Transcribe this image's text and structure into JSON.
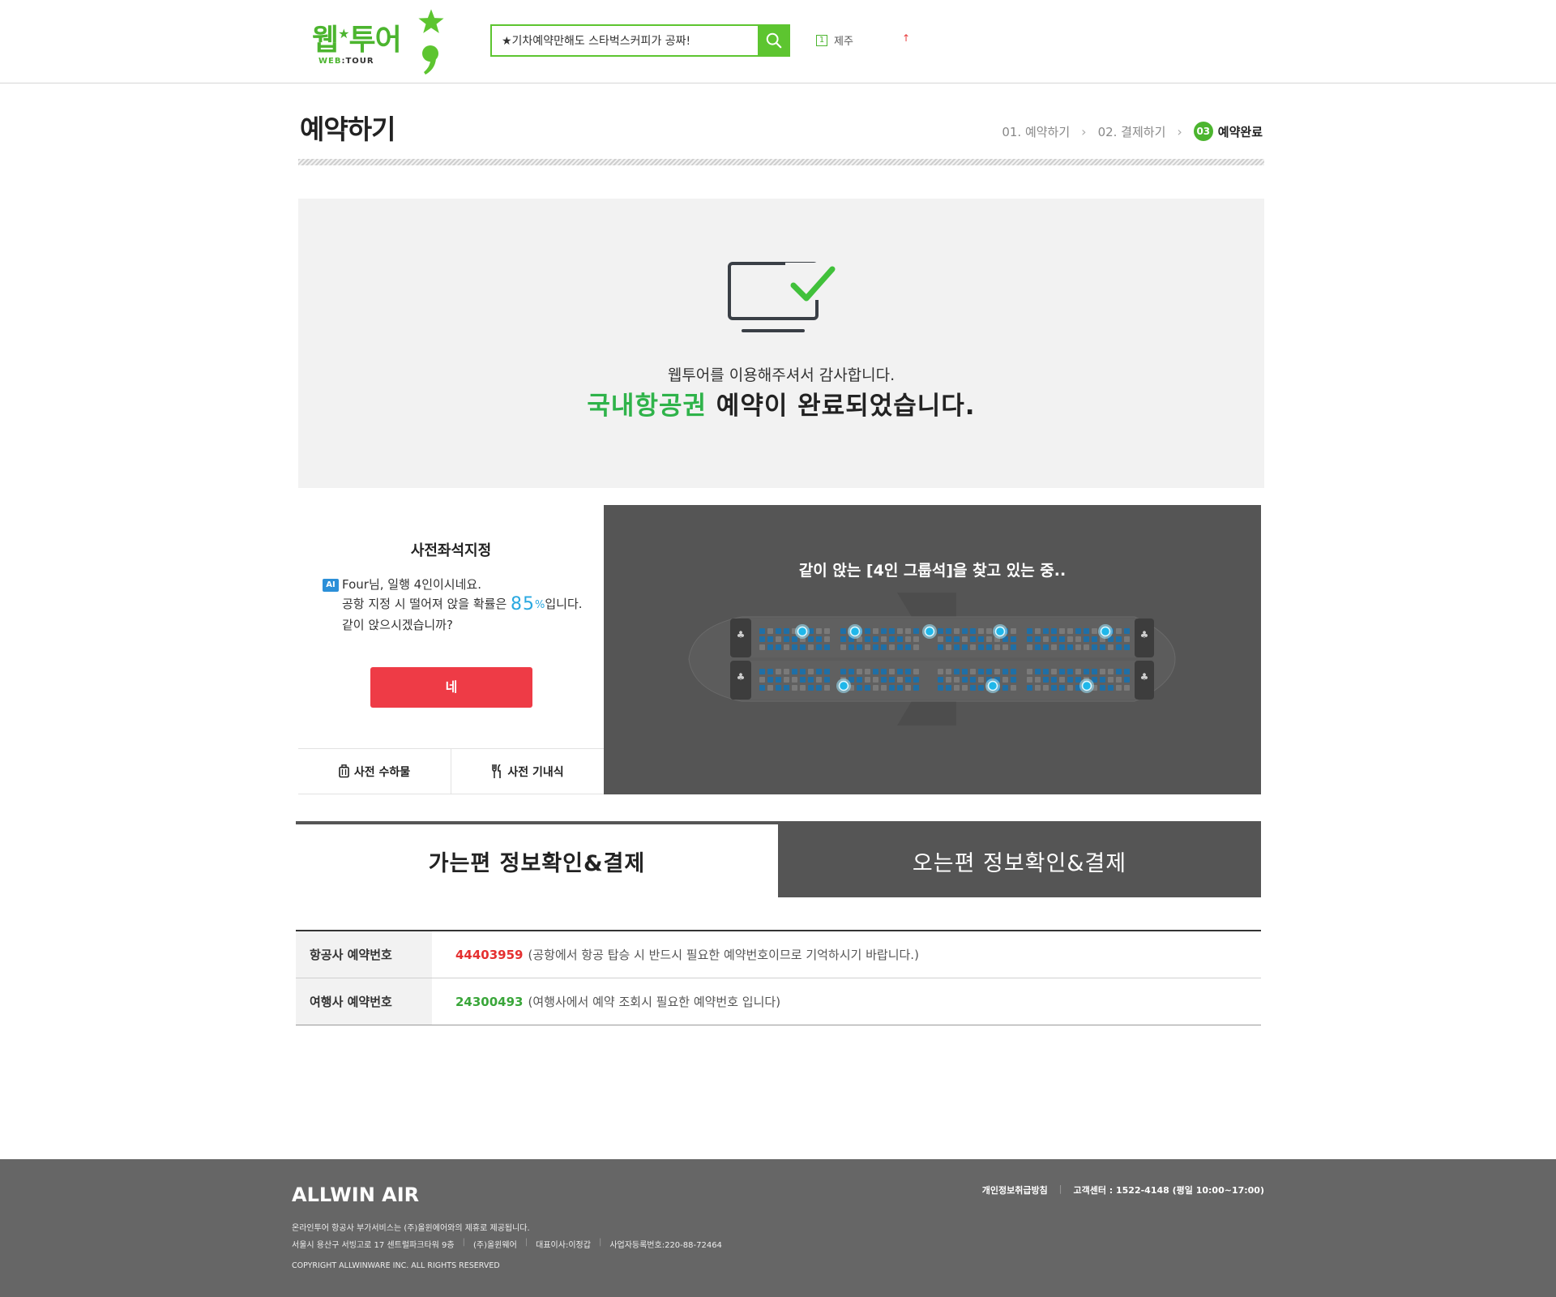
{
  "header": {
    "logo_main": "웹",
    "logo_semicolon": "★",
    "logo_tail": "투어",
    "logo_sub_a": "WEB",
    "logo_sub_b": "TOUR",
    "search_value": "★기차예약만해도 스타벅스커피가 공짜!",
    "rank_number": "1",
    "rank_keyword": "제주",
    "rank_trend": "↑"
  },
  "page": {
    "title": "예약하기",
    "steps": [
      {
        "label": "01. 예약하기"
      },
      {
        "label": "02. 결제하기"
      },
      {
        "number": "03",
        "label": "예약완료"
      }
    ]
  },
  "completion": {
    "thanks": "웹투어를 이용해주셔서 감사합니다.",
    "highlight": "국내항공권",
    "message": " 예약이 완료되었습니다."
  },
  "seat_promo": {
    "title": "사전좌석지정",
    "ai_badge": "AI",
    "line1": "Four님, 일행 4인이시네요.",
    "line2_pre": "공항 지정 시 떨어져 앉을 확률은 ",
    "percent": "85",
    "percent_sign": "%",
    "line2_post": "입니다.",
    "line3": "같이 앉으시겠습니까?",
    "yes_button": "네",
    "tab_baggage": "사전 수하물",
    "tab_meal": "사전 기내식",
    "search_title": "같이 앉는 [4인 그룹석]을 찾고 있는 중.."
  },
  "leg_tabs": {
    "outbound": "가는편 정보확인&결제",
    "return": "오는편 정보확인&결제"
  },
  "reservation": {
    "rows": [
      {
        "label": "항공사 예약번호",
        "number": "44403959",
        "note": "(공항에서 항공 탑승 시 반드시 필요한 예약번호이므로 기억하시기 바랍니다.)"
      },
      {
        "label": "여행사 예약번호",
        "number": "24300493",
        "note": "(여행사에서 예약 조회시 필요한 예약번호 입니다)"
      }
    ]
  },
  "footer": {
    "brand": "ALLWIN AIR",
    "privacy": "개인정보취급방침",
    "support": "고객센터 : 1522-4148 (평일 10:00~17:00)",
    "line1": "온라인투어 항공사 부가서비스는 (주)올윈에어와의 제휴로 제공됩니다.",
    "address": "서울시 용산구 서빙고로 17 센트럴파크타워 9층",
    "company": "(주)올윈웨어",
    "ceo": "대표이사:이정갑",
    "bizno": "사업자등록번호:220-88-72464",
    "copyright": "COPYRIGHT ALLWINWARE INC. ALL RIGHTS RESERVED"
  },
  "colors": {
    "brand_green": "#4cb52f",
    "alert_red": "#ee3b46",
    "dark_panel": "#555555",
    "seat_blue": "#1f6fa6",
    "highlight_cyan": "#29a8e0"
  }
}
